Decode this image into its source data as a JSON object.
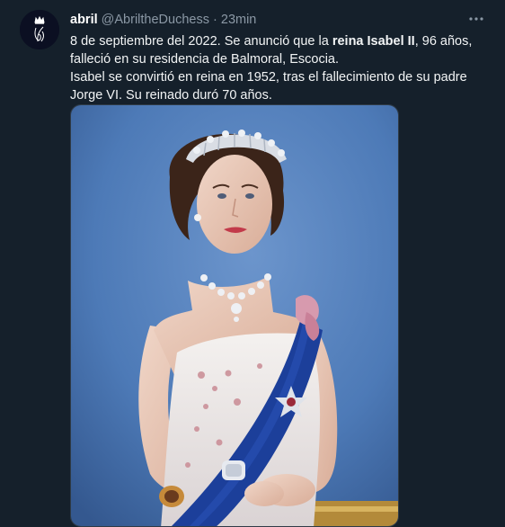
{
  "tweet": {
    "author_name": "abril",
    "author_handle": "@AbriltheDuchess",
    "separator": "·",
    "time": "23min",
    "text_line1_before": "8 de septiembre del 2022. Se anunció que la ",
    "text_line1_bold": "reina Isabel II",
    "text_line1_after": ", 96 años, falleció en su residencia de Balmoral, Escocia.",
    "text_line2": "Isabel se convirtió en reina en 1952, tras el fallecimiento de su padre Jorge VI. Su reinado duró 70 años.",
    "more_icon": "more-horizontal-icon",
    "avatar_icon": "crown-monogram-icon"
  },
  "colors": {
    "background": "#15202b",
    "secondary_text": "#8b98a5",
    "photo_background": "#4d7ab7",
    "sash": "#1c3f9a"
  }
}
